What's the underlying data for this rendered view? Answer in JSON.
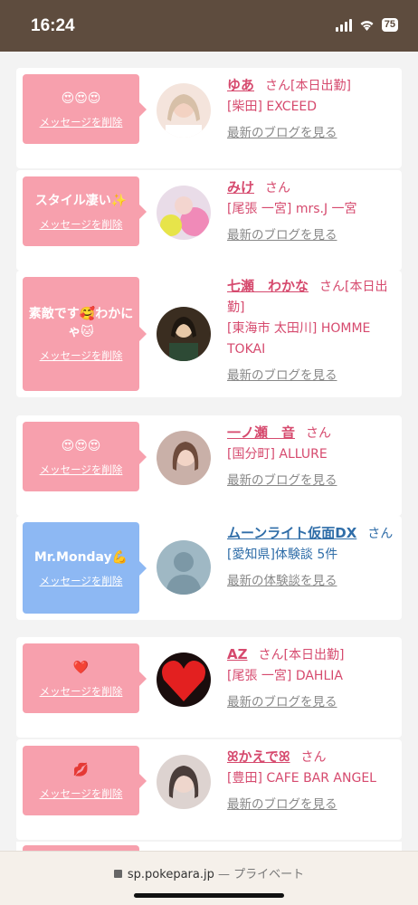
{
  "status": {
    "time": "16:24",
    "battery": "75"
  },
  "items": [
    {
      "message": "😍😍😍",
      "delete_label": "メッセージを削除",
      "name": "ゆあ",
      "suffix": "さん[本日出勤]",
      "shop": "[柴田] EXCEED",
      "link": "最新のブログを見る",
      "theme": "pink"
    },
    {
      "message": "スタイル凄い✨",
      "delete_label": "メッセージを削除",
      "name": "みけ",
      "suffix": "さん",
      "shop": "[尾張 一宮] mrs.J 一宮",
      "link": "最新のブログを見る",
      "theme": "pink"
    },
    {
      "message": "素敵です🥰わかにゃ🐱",
      "delete_label": "メッセージを削除",
      "name": "七瀬　わかな",
      "suffix": "さん[本日出勤]",
      "shop": "[東海市 太田川] HOMME TOKAI",
      "link": "最新のブログを見る",
      "theme": "pink"
    },
    {
      "message": "😍😍😍",
      "delete_label": "メッセージを削除",
      "name": "一ノ瀬　音",
      "suffix": "さん",
      "shop": "[国分町] ALLURE",
      "link": "最新のブログを見る",
      "theme": "pink"
    },
    {
      "message": "Mr.Monday💪",
      "delete_label": "メッセージを削除",
      "name": "ムーンライト仮面DX",
      "suffix": "さん",
      "shop": "[愛知県]体験談 5件",
      "link": "最新の体験談を見る",
      "theme": "blue"
    },
    {
      "message": "❤️",
      "delete_label": "メッセージを削除",
      "name": "AZ",
      "suffix": "さん[本日出勤]",
      "shop": "[尾張 一宮] DAHLIA",
      "link": "最新のブログを見る",
      "theme": "pink"
    },
    {
      "message": "💋",
      "delete_label": "メッセージを削除",
      "name": "ꕤかえでꕤ",
      "suffix": "さん",
      "shop": "[豊田] CAFE BAR ANGEL",
      "link": "最新のブログを見る",
      "theme": "pink"
    }
  ],
  "url_bar": {
    "domain": "sp.pokepara.jp",
    "mode": " — プライベート"
  },
  "colors": {
    "accent_pink": "#f7a0ad",
    "accent_blue": "#8db8f3",
    "name_pink": "#d64a6e",
    "name_blue": "#2f6da8",
    "status_bg": "#5e4c3e"
  }
}
